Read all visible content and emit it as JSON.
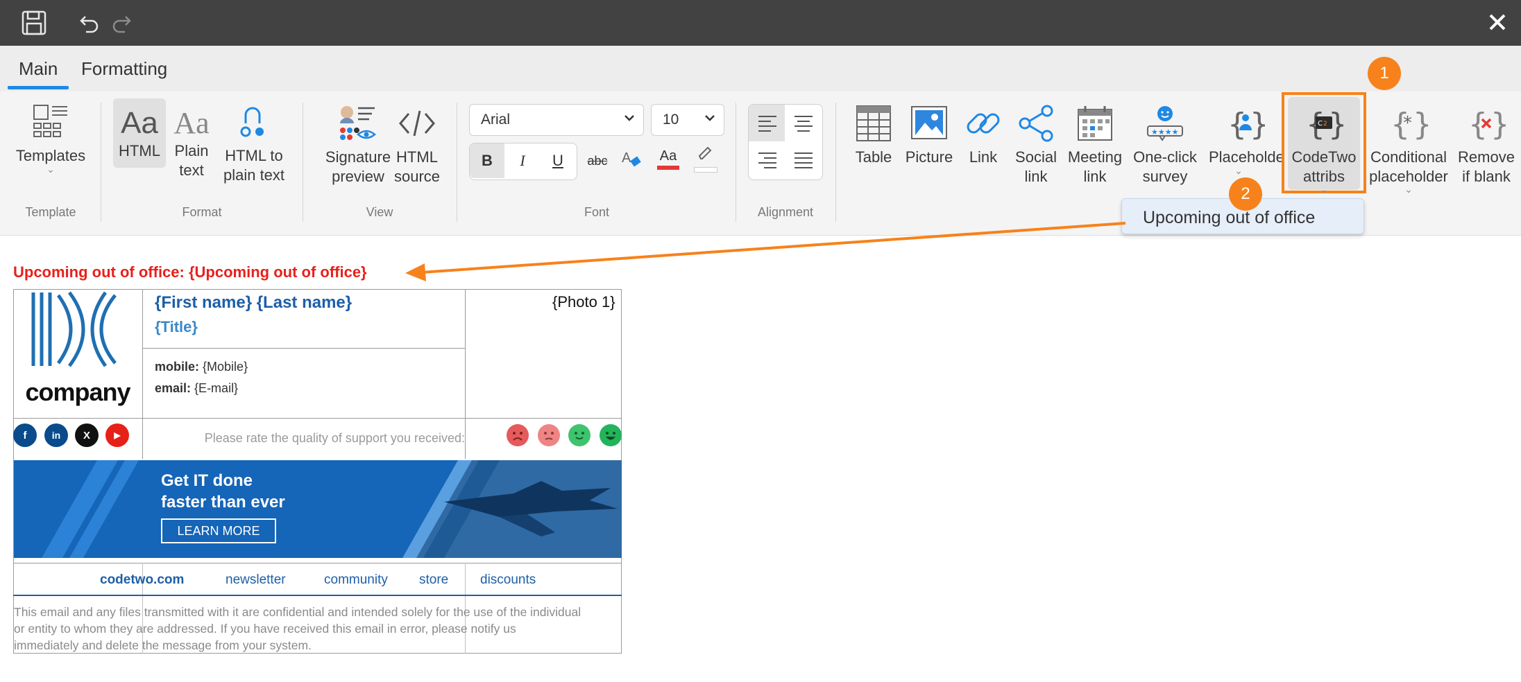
{
  "ribbon": {
    "tabs": [
      "Main",
      "Formatting"
    ],
    "buttons": {
      "templates": "Templates",
      "html": "HTML",
      "plain_text_1": "Plain",
      "plain_text_2": "text",
      "html_to_plain_1": "HTML to",
      "html_to_plain_2": "plain text",
      "sig_preview_1": "Signature",
      "sig_preview_2": "preview",
      "html_source_1": "HTML",
      "html_source_2": "source",
      "table": "Table",
      "picture": "Picture",
      "link": "Link",
      "social_link_1": "Social",
      "social_link_2": "link",
      "meeting_link_1": "Meeting",
      "meeting_link_2": "link",
      "survey_1": "One-click",
      "survey_2": "survey",
      "placeholder": "Placeholder",
      "codetwo_1": "CodeTwo",
      "codetwo_2": "attribs",
      "conditional_1": "Conditional",
      "conditional_2": "placeholder",
      "remove_1": "Remove",
      "remove_2": "if blank"
    },
    "groups": {
      "template": "Template",
      "format": "Format",
      "view": "View",
      "font": "Font",
      "alignment": "Alignment"
    },
    "font": {
      "family": "Arial",
      "size": "10",
      "bold": "B",
      "italic": "I",
      "underline": "U",
      "strike": "abc",
      "font_color": "Aa"
    },
    "dropdown_item": "Upcoming out of office",
    "callouts": [
      "1",
      "2"
    ],
    "accent_color": "#f7821b"
  },
  "signature": {
    "ooo_line": "Upcoming out of office: {Upcoming out of office}",
    "logo_text": "company",
    "name": "{First name} {Last name}",
    "title": "{Title}",
    "photo": "{Photo 1}",
    "mobile_label": "mobile:",
    "mobile_value": "{Mobile}",
    "email_label": "email:",
    "email_value": "{E-mail}",
    "social_icons": [
      "f",
      "in",
      "X",
      "▶"
    ],
    "rate_text": "Please rate the quality of support you received:",
    "banner": {
      "line1": "Get IT done",
      "line2": "faster than ever",
      "button": "LEARN MORE"
    },
    "footer_links": [
      "codetwo.com",
      "newsletter",
      "community",
      "store",
      "discounts"
    ],
    "disclaimer": [
      "This email and any files transmitted with it are confidential and intended solely for the use of the individual",
      "or entity to whom they are addressed. If you have received this email in error, please notify us",
      "immediately and delete the message from your system."
    ]
  }
}
